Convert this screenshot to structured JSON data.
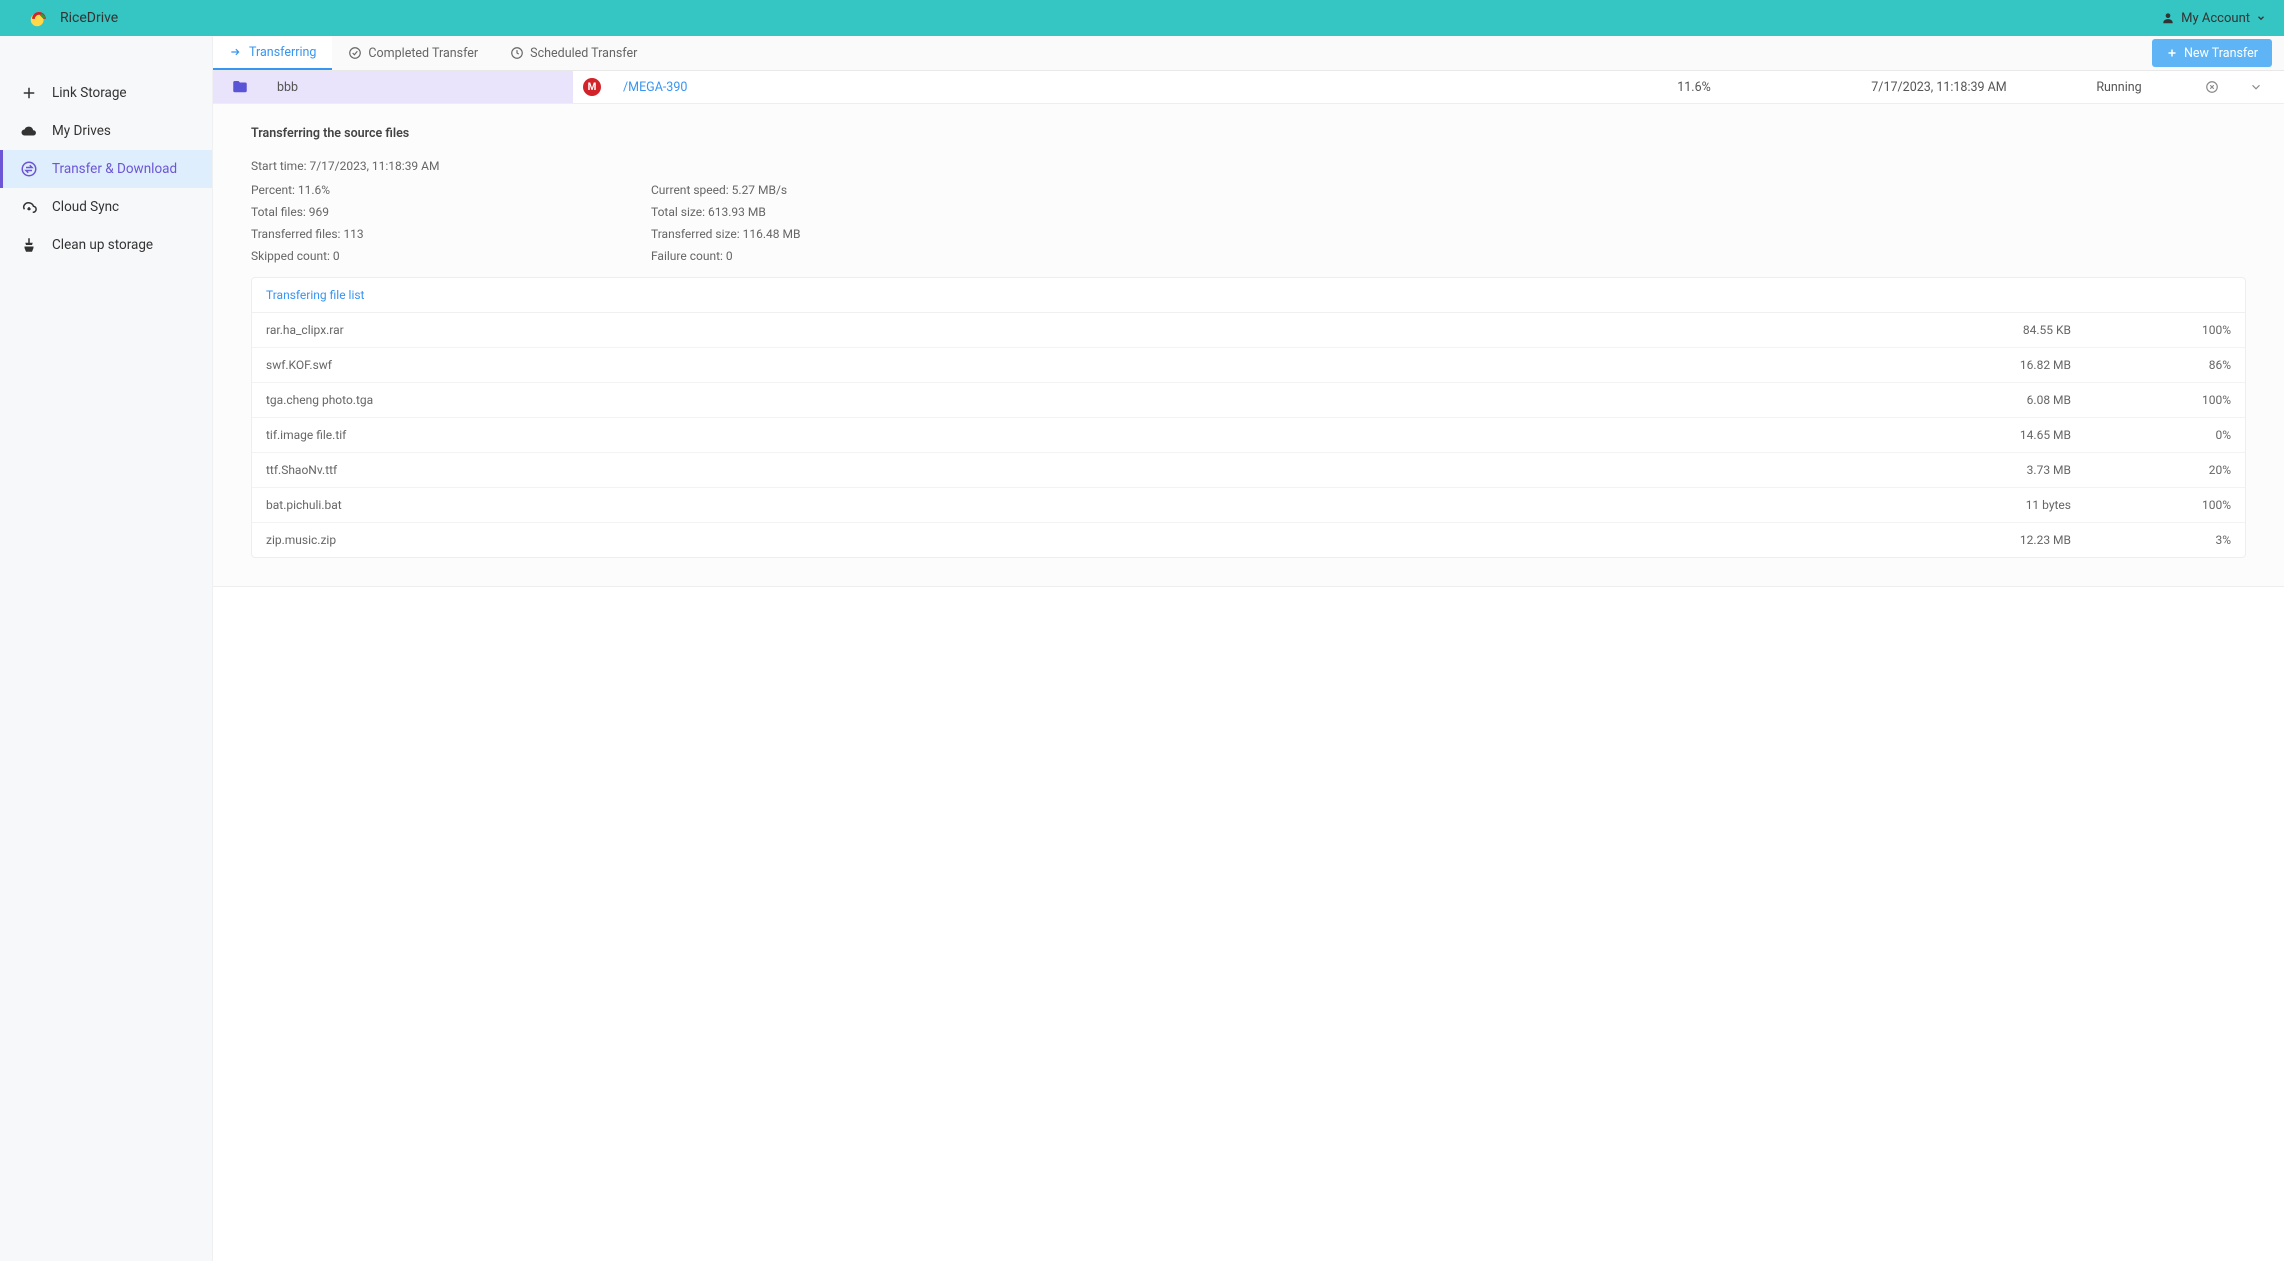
{
  "header": {
    "brand": "RiceDrive",
    "account_label": "My Account"
  },
  "sidebar": {
    "items": [
      {
        "label": "Link Storage"
      },
      {
        "label": "My Drives"
      },
      {
        "label": "Transfer & Download"
      },
      {
        "label": "Cloud Sync"
      },
      {
        "label": "Clean up storage"
      }
    ]
  },
  "tabs": {
    "transferring": "Transferring",
    "completed": "Completed Transfer",
    "scheduled": "Scheduled Transfer",
    "new_transfer": "New Transfer"
  },
  "job": {
    "source_name": "bbb",
    "dest_path": "/MEGA-390",
    "percent": "11.6%",
    "timestamp": "7/17/2023, 11:18:39 AM",
    "status": "Running"
  },
  "details": {
    "title": "Transferring the source files",
    "start_time_label": "Start time: ",
    "start_time": "7/17/2023, 11:18:39 AM",
    "percent_label": "Percent: ",
    "percent": "11.6%",
    "total_files_label": "Total files: ",
    "total_files": "969",
    "transferred_files_label": "Transferred files: ",
    "transferred_files": "113",
    "skipped_label": "Skipped count: ",
    "skipped": "0",
    "speed_label": "Current speed: ",
    "speed": "5.27 MB/s",
    "total_size_label": "Total size: ",
    "total_size": "613.93 MB",
    "transferred_size_label": "Transferred size: ",
    "transferred_size": "116.48 MB",
    "failure_label": "Failure count: ",
    "failure": "0"
  },
  "file_list": {
    "header": "Transfering file list",
    "rows": [
      {
        "name": "rar.ha_clipx.rar",
        "size": "84.55 KB",
        "progress": "100%"
      },
      {
        "name": "swf.KOF.swf",
        "size": "16.82 MB",
        "progress": "86%"
      },
      {
        "name": "tga.cheng photo.tga",
        "size": "6.08 MB",
        "progress": "100%"
      },
      {
        "name": "tif.image file.tif",
        "size": "14.65 MB",
        "progress": "0%"
      },
      {
        "name": "ttf.ShaoNv.ttf",
        "size": "3.73 MB",
        "progress": "20%"
      },
      {
        "name": "bat.pichuli.bat",
        "size": "11 bytes",
        "progress": "100%"
      },
      {
        "name": "zip.music.zip",
        "size": "12.23 MB",
        "progress": "3%"
      }
    ]
  }
}
